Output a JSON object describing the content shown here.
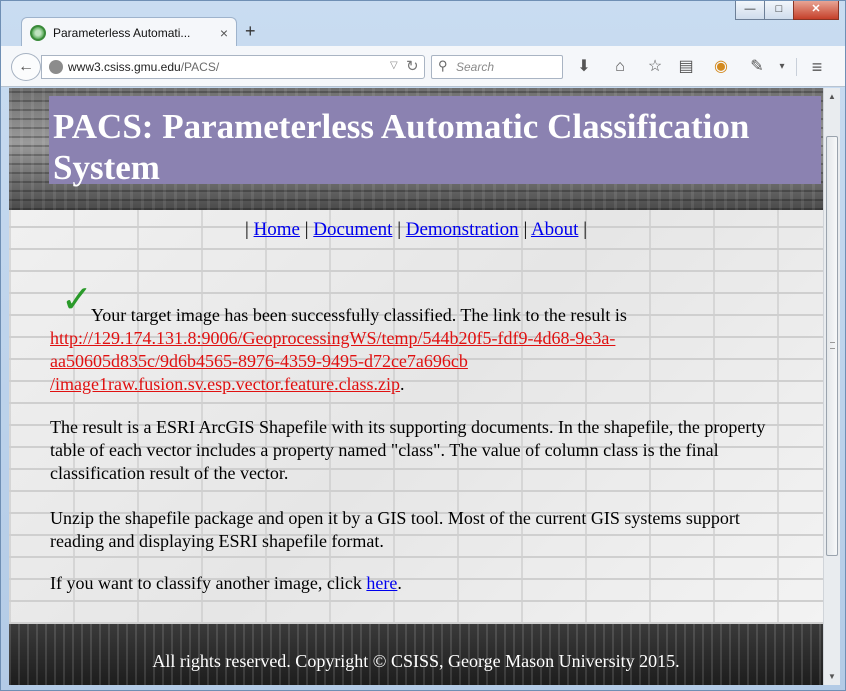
{
  "browser": {
    "tab_title": "Parameterless Automati...",
    "tab_close": "×",
    "new_tab": "+",
    "url_host": "www3.csiss.gmu.edu",
    "url_path": "/PACS/",
    "search_placeholder": "Search",
    "window_controls": {
      "minimize": "—",
      "maximize": "□",
      "close": "✕"
    },
    "toolbar_icons": [
      "download-icon",
      "home-icon",
      "bookmark-star-icon",
      "reading-list-icon",
      "pocket-icon",
      "extension-icon",
      "menu-icon"
    ]
  },
  "page": {
    "banner_title": "PACS: Parameterless Automatic Classification System",
    "nav": {
      "sep": "|",
      "home": "Home",
      "document": "Document",
      "demonstration": "Demonstration",
      "about": "About"
    },
    "success": {
      "lead": "Your target image has been successfully classified. The link to the result is",
      "link_line1": "http://129.174.131.8:9006/GeoprocessingWS/temp/544b20f5-fdf9-4d68-9e3a-",
      "link_line2": "aa50605d835c/9d6b4565-8976-4359-9495-d72ce7a696cb",
      "link_line3": "/image1raw.fusion.sv.esp.vector.feature.class.zip",
      "link_end": "."
    },
    "result_desc": "The result is a ESRI ArcGIS Shapefile with its supporting documents. In the shapefile, the property table of each vector includes a property named \"class\". The value of column class is the final classification result of the vector.",
    "unzip_desc": "Unzip the shapefile package and open it by a GIS tool. Most of the current GIS systems support reading and displaying ESRI shapefile format.",
    "again": {
      "prefix": "If you want to classify another image, click ",
      "link": "here",
      "suffix": "."
    },
    "footer": "All rights reserved. Copyright © CSISS, George Mason University 2015."
  },
  "colors": {
    "banner_bg": "#8b82b1",
    "link": "#0000ee",
    "result_link": "#e01010",
    "check": "#2a9a2a"
  }
}
